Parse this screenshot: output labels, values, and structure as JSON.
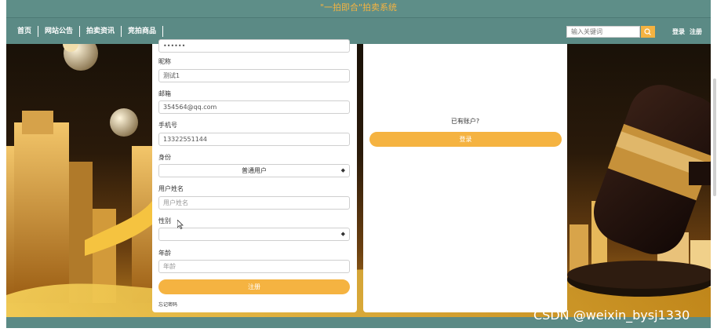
{
  "header": {
    "title": "\"一拍即合\"拍卖系统"
  },
  "nav": {
    "items": [
      "首页",
      "网站公告",
      "拍卖资讯",
      "竞拍商品"
    ],
    "search_placeholder": "输入关键词",
    "login": "登录",
    "register": "注册"
  },
  "register_form": {
    "password_value": "••••••",
    "nickname_label": "昵称",
    "nickname_value": "测试1",
    "email_label": "邮箱",
    "email_value": "354564@qq.com",
    "phone_label": "手机号",
    "phone_value": "13322551144",
    "role_label": "身份",
    "role_value": "普通用户",
    "name_label": "用户姓名",
    "name_placeholder": "用户姓名",
    "gender_label": "性别",
    "gender_value": "",
    "age_label": "年龄",
    "age_placeholder": "年龄",
    "submit": "注册",
    "forgot": "忘记密码"
  },
  "login_panel": {
    "have_account": "已有账户?",
    "login_button": "登录"
  },
  "watermark": "CSDN @weixin_bysj1330",
  "colors": {
    "accent": "#f5b341",
    "nav_bg": "#5b8a85",
    "title_text": "#f5b341"
  }
}
